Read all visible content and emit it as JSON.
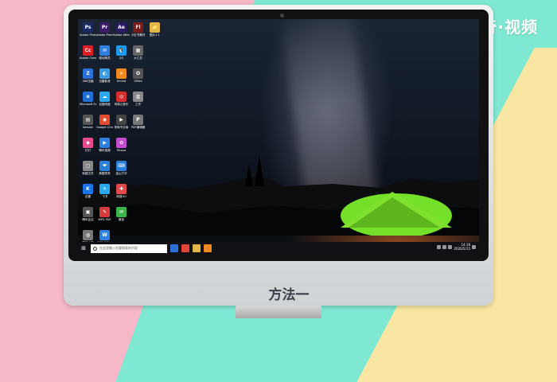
{
  "brand": {
    "text": "天奇·视频"
  },
  "caption": {
    "text": "方法一"
  },
  "desktop_icons": [
    {
      "label": "Adobe Photosh...",
      "glyph": "Ps",
      "color": "#1b2a63"
    },
    {
      "label": "Adobe Premiere P...",
      "glyph": "Pr",
      "color": "#3b1b63"
    },
    {
      "label": "Adobe After Effects CC",
      "glyph": "Ae",
      "color": "#2a1b63"
    },
    {
      "label": "小红书素材",
      "glyph": "Fl",
      "color": "#7a1b1b"
    },
    {
      "label": "图片1.1",
      "glyph": "📁",
      "color": "#e2b647"
    },
    {
      "label": "Adobe Creati...",
      "glyph": "Cc",
      "color": "#da1f26"
    },
    {
      "label": "驱动精灵",
      "glyph": "✉",
      "color": "#2f7fe0"
    },
    {
      "label": "QQ",
      "glyph": "🐧",
      "color": "#1b9af0"
    },
    {
      "label": "大汇总",
      "glyph": "▦",
      "color": "#666"
    },
    {
      "label": "",
      "glyph": "",
      "color": "transparent"
    },
    {
      "label": "360压缩",
      "glyph": "Z",
      "color": "#2a6ed8"
    },
    {
      "label": "迅雷影音",
      "glyph": "◐",
      "color": "#3a9be0"
    },
    {
      "label": "Xmind",
      "glyph": "✕",
      "color": "#f08a1e"
    },
    {
      "label": "Office",
      "glyph": "O",
      "color": "#555"
    },
    {
      "label": "",
      "glyph": "",
      "color": "transparent"
    },
    {
      "label": "Microsoft Edge",
      "glyph": "e",
      "color": "#1f6fd6"
    },
    {
      "label": "百度网盘",
      "glyph": "☁",
      "color": "#2aa8f0"
    },
    {
      "label": "网易云音乐",
      "glyph": "◎",
      "color": "#d32d2d"
    },
    {
      "label": "工作",
      "glyph": "▥",
      "color": "#888"
    },
    {
      "label": "",
      "glyph": "",
      "color": "transparent"
    },
    {
      "label": "Session",
      "glyph": "▤",
      "color": "#555"
    },
    {
      "label": "Google Chrome",
      "glyph": "◉",
      "color": "#e04a2f"
    },
    {
      "label": "剪映专业版",
      "glyph": "▶",
      "color": "#444"
    },
    {
      "label": "PDF编辑器",
      "glyph": "P",
      "color": "#777"
    },
    {
      "label": "",
      "glyph": "",
      "color": "transparent"
    },
    {
      "label": "钉钉",
      "glyph": "◆",
      "color": "#e64c8b"
    },
    {
      "label": "腾讯视频",
      "glyph": "▶",
      "color": "#2d7fe0"
    },
    {
      "label": "Picasa",
      "glyph": "✿",
      "color": "#c44cd0"
    },
    {
      "label": "",
      "glyph": "",
      "color": "transparent"
    },
    {
      "label": "",
      "glyph": "",
      "color": "transparent"
    },
    {
      "label": "新建文件",
      "glyph": "▢",
      "color": "#888"
    },
    {
      "label": "美图秀秀",
      "glyph": "❤",
      "color": "#2a7fd8"
    },
    {
      "label": "金山打字",
      "glyph": "⌨",
      "color": "#2a7fd8"
    },
    {
      "label": "",
      "glyph": "",
      "color": "transparent"
    },
    {
      "label": "",
      "glyph": "",
      "color": "transparent"
    },
    {
      "label": "迅雷",
      "glyph": "K",
      "color": "#1a73e8"
    },
    {
      "label": "飞书",
      "glyph": "✈",
      "color": "#2aa8f0"
    },
    {
      "label": "网易UU",
      "glyph": "✚",
      "color": "#e04a4a"
    },
    {
      "label": "",
      "glyph": "",
      "color": "transparent"
    },
    {
      "label": "",
      "glyph": "",
      "color": "transparent"
    },
    {
      "label": "腾讯会议",
      "glyph": "▣",
      "color": "#555"
    },
    {
      "label": "WPS PDF",
      "glyph": "✎",
      "color": "#d63b3b"
    },
    {
      "label": "微信",
      "glyph": "✉",
      "color": "#3bb54a"
    },
    {
      "label": "",
      "glyph": "",
      "color": "transparent"
    },
    {
      "label": "",
      "glyph": "",
      "color": "transparent"
    },
    {
      "label": "驱动人生",
      "glyph": "◍",
      "color": "#777"
    },
    {
      "label": "WPS Office",
      "glyph": "W",
      "color": "#2f7fe0"
    },
    {
      "label": "",
      "glyph": "",
      "color": "transparent"
    },
    {
      "label": "",
      "glyph": "",
      "color": "transparent"
    },
    {
      "label": "",
      "glyph": "",
      "color": "transparent"
    }
  ],
  "taskbar": {
    "search_placeholder": "在这里输入你要搜索的内容",
    "time": "14:18",
    "date": "2020/5/15"
  },
  "colors": {
    "bg_pink": "#f6b8c6",
    "bg_mint": "#7fe8d2",
    "bg_yellow": "#f9e6a3",
    "tent_green": "#7fe12e"
  }
}
